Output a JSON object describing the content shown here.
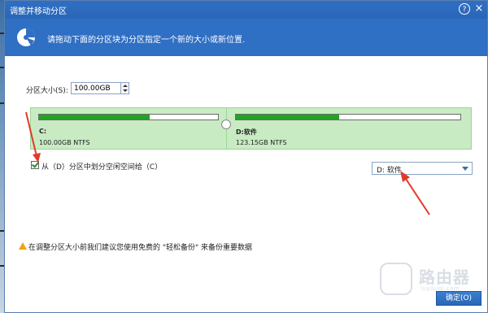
{
  "window": {
    "title": "调整并移动分区",
    "help_glyph": "?",
    "close_glyph": "×"
  },
  "banner": {
    "text": "请拖动下面的分区块为分区指定一个新的大小或新位置.",
    "icon": "pie-chart-icon"
  },
  "size": {
    "label": "分区大小(S):",
    "value": "100.00GB"
  },
  "partitions": [
    {
      "name": "C:",
      "info": "100.00GB NTFS",
      "used_fraction": 0.62
    },
    {
      "name": "D:软件",
      "info": "123.15GB NTFS",
      "used_fraction": 0.46
    }
  ],
  "allocate": {
    "label": "从（D）分区中划分空闲空间给（C）",
    "checked": true
  },
  "target_select": {
    "value": "D: 软件"
  },
  "warning": {
    "text": "在调整分区大小前我们建议您使用免费的 \"轻松备份\" 来备份重要数据"
  },
  "buttons": {
    "ok": "确定(O)"
  },
  "watermark": {
    "text": "路由器",
    "sub": "luyouqi.com"
  },
  "colors": {
    "title_bar": "#2f6fc4",
    "partition_bg": "#c8ebc3",
    "used_fill": "#22a322",
    "annotation_arrow": "#e23a2a"
  }
}
